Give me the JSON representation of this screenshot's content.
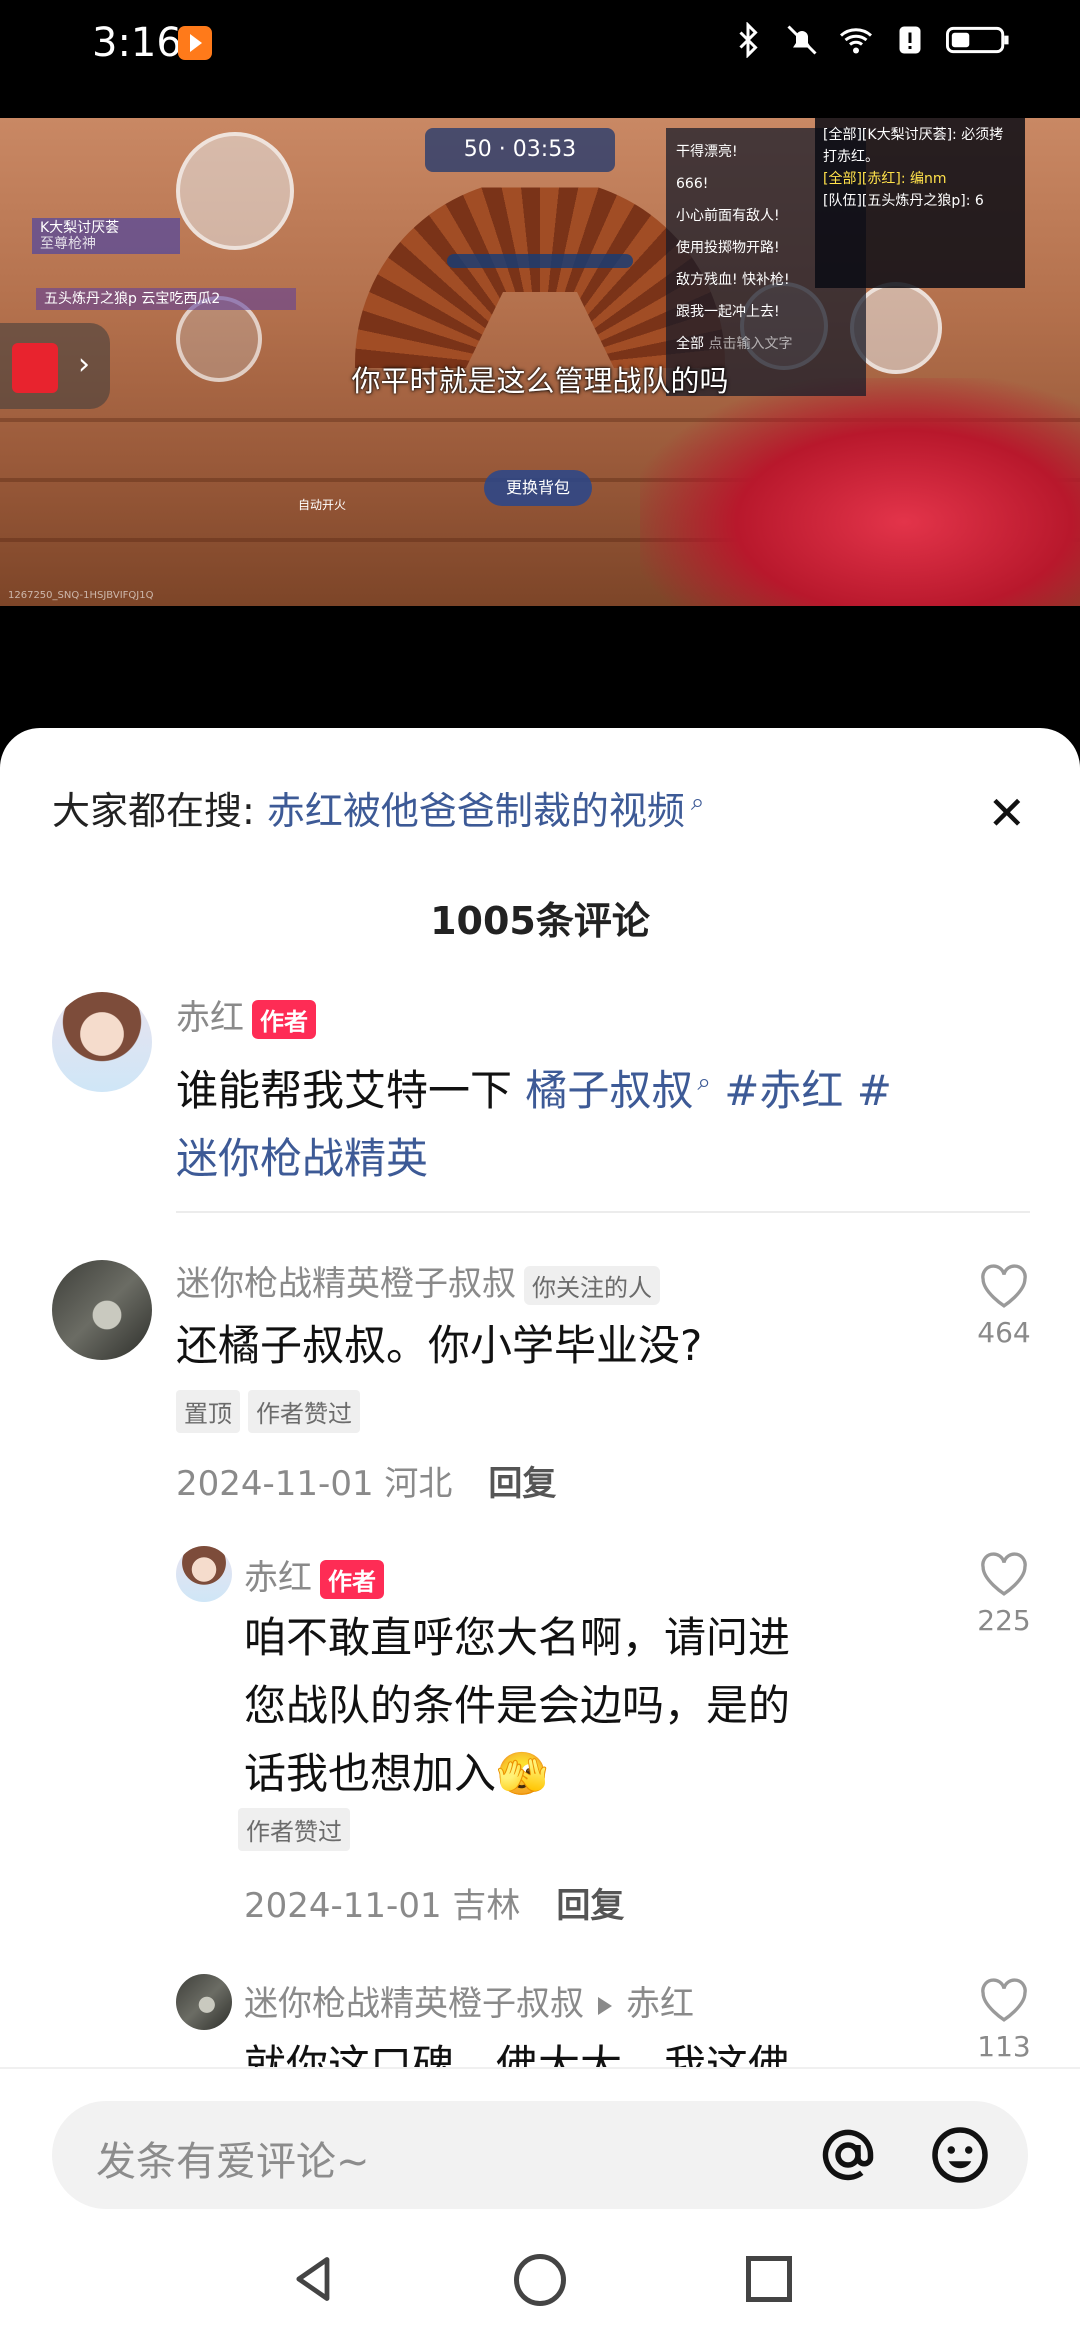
{
  "status_bar": {
    "time": "3:16",
    "icons": [
      "bluetooth-icon",
      "mute-icon",
      "wifi-icon",
      "alert-icon",
      "battery-icon"
    ]
  },
  "video": {
    "subtitle": "你平时就是这么管理战队的吗",
    "hud_score": "50",
    "hud_timer": "03:53",
    "change_bag_label": "更换背包",
    "chat_lines": [
      "干得漂亮!",
      "666!",
      "小心前面有敌人!",
      "使用投掷物开路!",
      "敌方残血! 快补枪!",
      "跟我一起冲上去!",
      "全部",
      "点击输入文字"
    ],
    "chat_top": [
      "[全部][K大梨讨厌荟]: 必须拷打赤红。",
      "[全部][赤红]: 编nm",
      "[队伍][五头炼丹之狼p]: 6"
    ],
    "player_tag": "K大梨讨厌荟",
    "player_tag_sub": "至尊枪神",
    "player_tag_2": "五头炼丹之狼p  云宝吃西瓜2",
    "watermark": "1267250_SNQ-1HSJBVIFQJ1Q",
    "auto_fire": "自动开火"
  },
  "sheet": {
    "search_prefix": "大家都在搜:",
    "search_keyword": "赤红被他爸爸制裁的视频",
    "comment_count": "1005条评论"
  },
  "post": {
    "author": "赤红",
    "author_tag": "作者",
    "text_plain": "谁能帮我艾特一下",
    "text_mention": "橘子叔叔",
    "text_tags_1": "#赤红 #",
    "text_tags_2": "迷你枪战精英"
  },
  "comments": [
    {
      "name": "迷你枪战精英橙子叔叔",
      "badge": "你关注的人",
      "text": "还橘子叔叔。你小学毕业没?",
      "chips": [
        "置顶",
        "作者赞过"
      ],
      "date": "2024-11-01 河北",
      "reply_label": "回复",
      "likes": "464"
    }
  ],
  "replies": [
    {
      "name": "赤红",
      "badge": "作者",
      "text_1": "咱不敢直呼您大名啊，请问进",
      "text_2": "您战队的条件是会边吗，是的",
      "text_3": "话我也想加入🫣",
      "chips": [
        "作者赞过"
      ],
      "date": "2024-11-01 吉林",
      "reply_label": "回复",
      "likes": "225"
    },
    {
      "name": "迷你枪战精英橙子叔叔",
      "reply_to": "赤红",
      "text": "就你这口碑，佛大大，我这佛",
      "likes": "113"
    }
  ],
  "input": {
    "placeholder": "发条有爱评论~"
  },
  "colors": {
    "accent_link": "#3d5a96",
    "author_tag": "#fe2c55"
  }
}
